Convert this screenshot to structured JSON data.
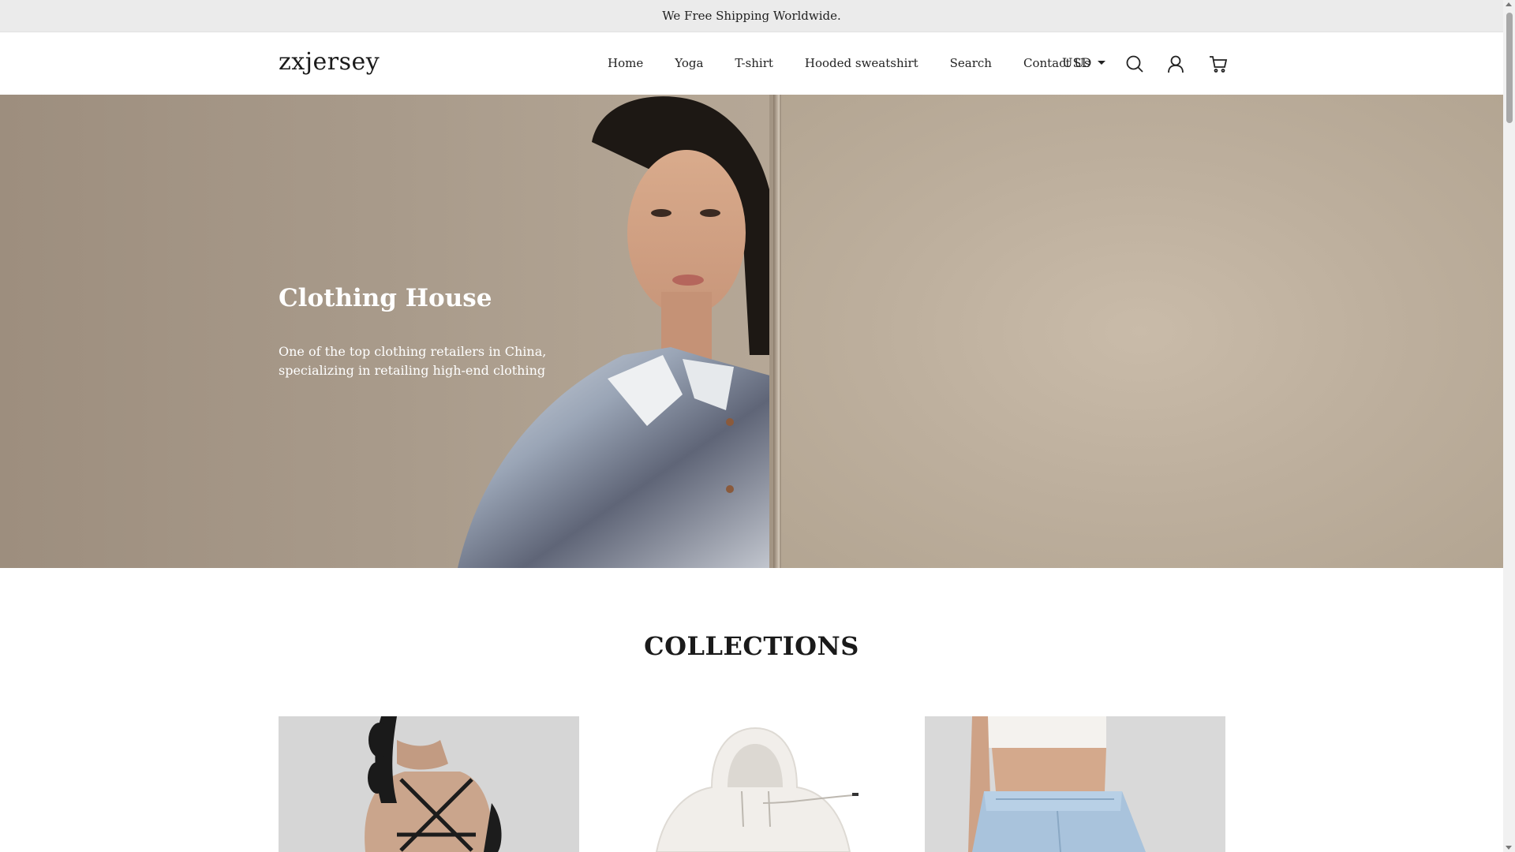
{
  "announcement": "We Free Shipping Worldwide.",
  "header": {
    "logo": "zxjersey",
    "nav": [
      "Home",
      "Yoga",
      "T-shirt",
      "Hooded sweatshirt",
      "Search",
      "Contact Us"
    ],
    "currency": "USD",
    "icons": [
      "search-icon",
      "account-icon",
      "cart-icon"
    ]
  },
  "hero": {
    "title": "Clothing House",
    "text": "One of the top clothing retailers in China, specializing in retailing high-end clothing"
  },
  "collections": {
    "title": "COLLECTIONS"
  },
  "colors": {
    "announcement_bg": "#ebebeb",
    "text": "#222222",
    "hero_text": "#ffffff"
  }
}
